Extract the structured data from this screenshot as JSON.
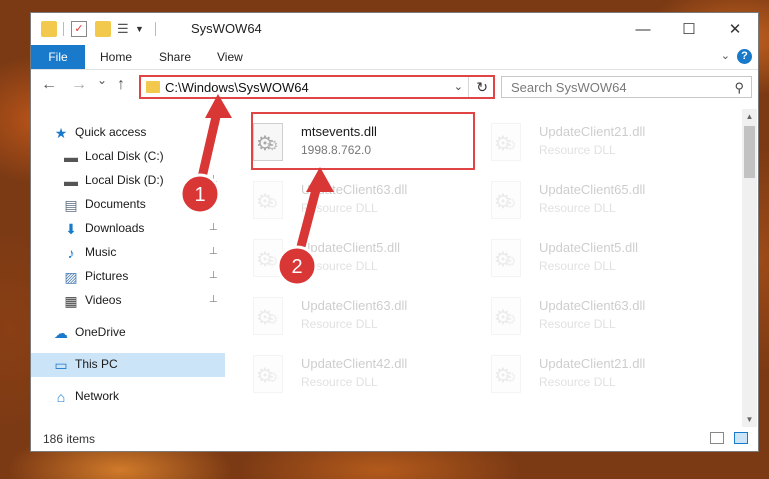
{
  "window": {
    "title": "SysWOW64",
    "controls": {
      "minimize": "—",
      "maximize": "☐",
      "close": "✕"
    }
  },
  "ribbon": {
    "tabs": [
      "File",
      "Home",
      "Share",
      "View"
    ],
    "help": "?"
  },
  "navigation": {
    "back": "←",
    "forward": "→",
    "recent": "⌄",
    "up": "↑",
    "address": "C:\\Windows\\SysWOW64",
    "address_dropdown": "⌄",
    "refresh": "↻",
    "search_placeholder": "Search SysWOW64",
    "search_icon": "⚲"
  },
  "sidebar": {
    "items": [
      {
        "label": "Quick access",
        "icon": "star-icon",
        "glyph": "★",
        "color": "#1979ca",
        "pinned": false
      },
      {
        "label": "Local Disk (C:)",
        "icon": "drive-icon",
        "glyph": "▬",
        "color": "#555555",
        "pinned": false
      },
      {
        "label": "Local Disk (D:)",
        "icon": "drive-icon",
        "glyph": "▬",
        "color": "#555555",
        "pinned": true
      },
      {
        "label": "Documents",
        "icon": "documents-icon",
        "glyph": "▤",
        "color": "#5a6b7d",
        "pinned": true
      },
      {
        "label": "Downloads",
        "icon": "download-icon",
        "glyph": "⬇",
        "color": "#1979ca",
        "pinned": true
      },
      {
        "label": "Music",
        "icon": "music-icon",
        "glyph": "♪",
        "color": "#1979ca",
        "pinned": true
      },
      {
        "label": "Pictures",
        "icon": "pictures-icon",
        "glyph": "▨",
        "color": "#4a7db5",
        "pinned": true
      },
      {
        "label": "Videos",
        "icon": "videos-icon",
        "glyph": "▦",
        "color": "#444444",
        "pinned": true
      },
      {
        "label": "OneDrive",
        "icon": "cloud-icon",
        "glyph": "☁",
        "color": "#1979ca",
        "pinned": false
      },
      {
        "label": "This PC",
        "icon": "computer-icon",
        "glyph": "▭",
        "color": "#1979ca",
        "pinned": false
      },
      {
        "label": "Network",
        "icon": "network-icon",
        "glyph": "⌂",
        "color": "#1979ca",
        "pinned": false
      }
    ],
    "pin_glyph": "📌"
  },
  "files": [
    {
      "name": "mtsevents.dll",
      "desc": "1998.8.762.0",
      "faded": false
    },
    {
      "name": "UpdateClient21.dll",
      "desc": "Resource DLL",
      "faded": true
    },
    {
      "name": "UpdateClient63.dll",
      "desc": "Resource DLL",
      "faded": true
    },
    {
      "name": "UpdateClient65.dll",
      "desc": "Resource DLL",
      "faded": true
    },
    {
      "name": "UpdateClient5.dll",
      "desc": "Resource DLL",
      "faded": true
    },
    {
      "name": "UpdateClient5.dll",
      "desc": "Resource DLL",
      "faded": true
    },
    {
      "name": "UpdateClient63.dll",
      "desc": "Resource DLL",
      "faded": true
    },
    {
      "name": "UpdateClient63.dll",
      "desc": "Resource DLL",
      "faded": true
    },
    {
      "name": "UpdateClient42.dll",
      "desc": "Resource DLL",
      "faded": true
    },
    {
      "name": "UpdateClient21.dll",
      "desc": "Resource DLL",
      "faded": true
    }
  ],
  "annotations": [
    {
      "label": "1",
      "color": "#d93636"
    },
    {
      "label": "2",
      "color": "#d93636"
    }
  ],
  "status": {
    "item_count": "186 items"
  },
  "colors": {
    "accent": "#1979ca",
    "highlight": "#e04444",
    "selected": "#cce4f7"
  }
}
